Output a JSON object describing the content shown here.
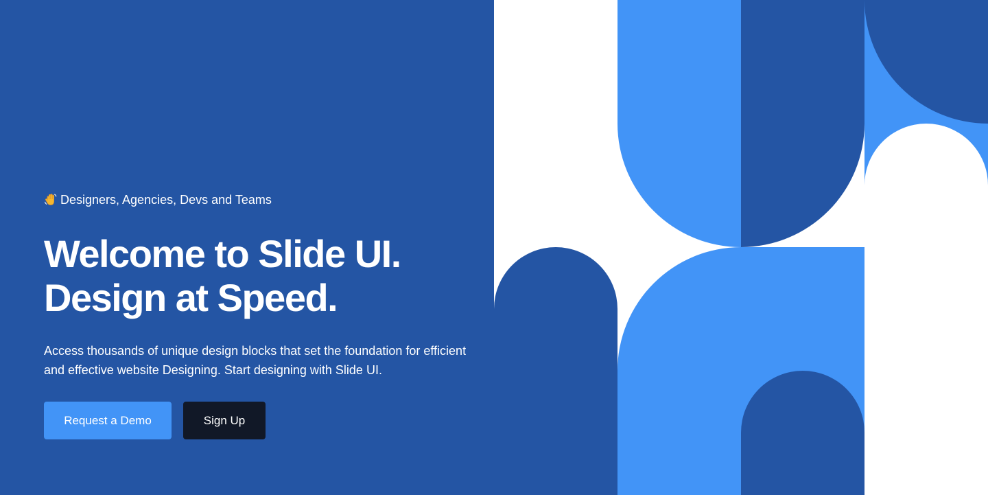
{
  "hero": {
    "eyebrow_icon": "waving-hand-icon",
    "eyebrow": "Designers, Agencies, Devs and Teams",
    "headline_line1": "Welcome to Slide UI.",
    "headline_line2": "Design at Speed.",
    "description": "Access thousands of unique design blocks that set the foundation for efficient and effective website Designing. Start designing with Slide UI.",
    "buttons": {
      "primary_label": "Request a Demo",
      "secondary_label": "Sign Up"
    }
  },
  "colors": {
    "background": "#2455A4",
    "accent_light_blue": "#4294F7",
    "dark_button": "#111827",
    "white": "#FFFFFF"
  }
}
